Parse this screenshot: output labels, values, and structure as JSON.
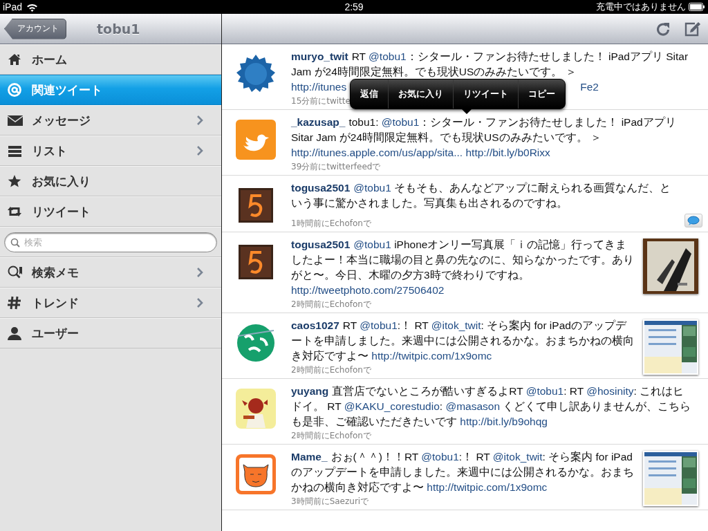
{
  "status_bar": {
    "device": "iPad",
    "time": "2:59",
    "battery_text": "充電中ではありません"
  },
  "sidebar": {
    "back_button": "アカウント",
    "title": "tobu1",
    "items": [
      {
        "label": "ホーム",
        "selected": false,
        "has_arrow": false
      },
      {
        "label": "関連ツイート",
        "selected": true,
        "has_arrow": false
      },
      {
        "label": "メッセージ",
        "selected": false,
        "has_arrow": true
      },
      {
        "label": "リスト",
        "selected": false,
        "has_arrow": true
      },
      {
        "label": "お気に入り",
        "selected": false,
        "has_arrow": false
      },
      {
        "label": "リツイート",
        "selected": false,
        "has_arrow": false
      }
    ],
    "search": {
      "placeholder": "検索"
    },
    "items_after": [
      {
        "label": "検索メモ",
        "selected": false,
        "has_arrow": true
      },
      {
        "label": "トレンド",
        "selected": false,
        "has_arrow": true
      },
      {
        "label": "ユーザー",
        "selected": false,
        "has_arrow": false
      }
    ]
  },
  "timeline": {
    "popover": {
      "buttons": [
        "返信",
        "お気に入り",
        "リツイート",
        "コピー"
      ]
    },
    "tweets": [
      {
        "user": "muryo_twit",
        "avatar": {
          "kind": "picture"
        },
        "segments": [
          {
            "kind": "text",
            "text": "RT "
          },
          {
            "kind": "mention",
            "text": "@tobu1"
          },
          {
            "kind": "text",
            "text": "：シタール・ファンお待たせしました！ iPadアプリ Sitar Jam が24時間限定無料。でも現状USのみみたいです。 ＞"
          }
        ],
        "tail": [
          {
            "kind": "link",
            "text": "http://itunes"
          },
          {
            "kind": "link",
            "text": "Fe2"
          }
        ],
        "meta": "15分前にtwitte",
        "replied": false
      },
      {
        "user": "_kazusap_",
        "avatar": {
          "kind": "picture"
        },
        "segments": [
          {
            "kind": "text",
            "text": "tobu1: "
          },
          {
            "kind": "mention",
            "text": "@tobu1"
          },
          {
            "kind": "text",
            "text": "：シタール・ファンお待たせしました！ iPadアプリ Sitar Jam が24時間限定無料。でも現状USのみみたいです。 ＞ "
          },
          {
            "kind": "link",
            "text": "http://itunes.apple.com/us/app/sita..."
          },
          {
            "kind": "link",
            "text": " http://bit.ly/b0Rixx"
          }
        ],
        "meta": "39分前にtwitterfeedで",
        "replied": false
      },
      {
        "user": "togusa2501",
        "avatar": {
          "kind": "picture"
        },
        "segments": [
          {
            "kind": "mention",
            "text": "@tobu1"
          },
          {
            "kind": "text",
            "text": " そもそも、あんなどアップに耐えられる画質なんだ、という事に驚かされました。写真集も出されるのですね。"
          }
        ],
        "meta": "1時間前にEchofonで",
        "replied": true
      },
      {
        "user": "togusa2501",
        "avatar": {
          "kind": "picture"
        },
        "segments": [
          {
            "kind": "mention",
            "text": "@tobu1"
          },
          {
            "kind": "text",
            "text": " iPhoneオンリー写真展「ｉの記憶」行ってきましたよー！本当に職場の目と鼻の先なのに、知らなかったです。ありがと〜。今日、木曜の夕方3時で終わりですね。 "
          },
          {
            "kind": "link",
            "text": "http://tweetphoto.com/27506402"
          }
        ],
        "thumbnail": {
          "kind": "picture"
        },
        "meta": "2時間前にEchofonで",
        "replied": false
      },
      {
        "user": "caos1027",
        "avatar": {
          "kind": "picture"
        },
        "segments": [
          {
            "kind": "text",
            "text": "RT "
          },
          {
            "kind": "mention",
            "text": "@tobu1"
          },
          {
            "kind": "text",
            "text": ":！ RT "
          },
          {
            "kind": "mention",
            "text": "@itok_twit"
          },
          {
            "kind": "text",
            "text": ": そら案内 for iPadのアップデートを申請しました。来週中には公開されるかな。おまちかねの横向き対応ですよ〜 "
          },
          {
            "kind": "link",
            "text": "http://twitpic.com/1x9omc"
          }
        ],
        "thumbnail": {
          "kind": "picture"
        },
        "meta": "2時間前にEchofonで",
        "replied": false
      },
      {
        "user": "yuyang",
        "avatar": {
          "kind": "picture"
        },
        "segments": [
          {
            "kind": "text",
            "text": "直営店でないところが酷いすぎるよRT "
          },
          {
            "kind": "mention",
            "text": "@tobu1"
          },
          {
            "kind": "text",
            "text": ": RT "
          },
          {
            "kind": "mention",
            "text": "@hosinity"
          },
          {
            "kind": "text",
            "text": ": これはヒドイ。 RT "
          },
          {
            "kind": "mention",
            "text": "@KAKU_corestudio"
          },
          {
            "kind": "text",
            "text": ": "
          },
          {
            "kind": "mention",
            "text": "@masason"
          },
          {
            "kind": "text",
            "text": " くどくて申し訳ありませんが、こちらも是非、ご確認いただきたいです "
          },
          {
            "kind": "link",
            "text": "http://bit.ly/b9ohqg"
          }
        ],
        "meta": "2時間前にEchofonで",
        "replied": false
      },
      {
        "user": "Mame_",
        "avatar": {
          "kind": "picture"
        },
        "segments": [
          {
            "kind": "text",
            "text": "おぉ(＾＾)！！RT "
          },
          {
            "kind": "mention",
            "text": "@tobu1"
          },
          {
            "kind": "text",
            "text": ":！ RT "
          },
          {
            "kind": "mention",
            "text": "@itok_twit"
          },
          {
            "kind": "text",
            "text": ": そら案内 for iPadのアップデートを申請しました。来週中には公開されるかな。おまちかねの横向き対応ですよ〜 "
          },
          {
            "kind": "link",
            "text": "http://twitpic.com/1x9omc"
          }
        ],
        "thumbnail": {
          "kind": "picture"
        },
        "meta": "3時間前にSaezuriで",
        "replied": false
      }
    ]
  }
}
